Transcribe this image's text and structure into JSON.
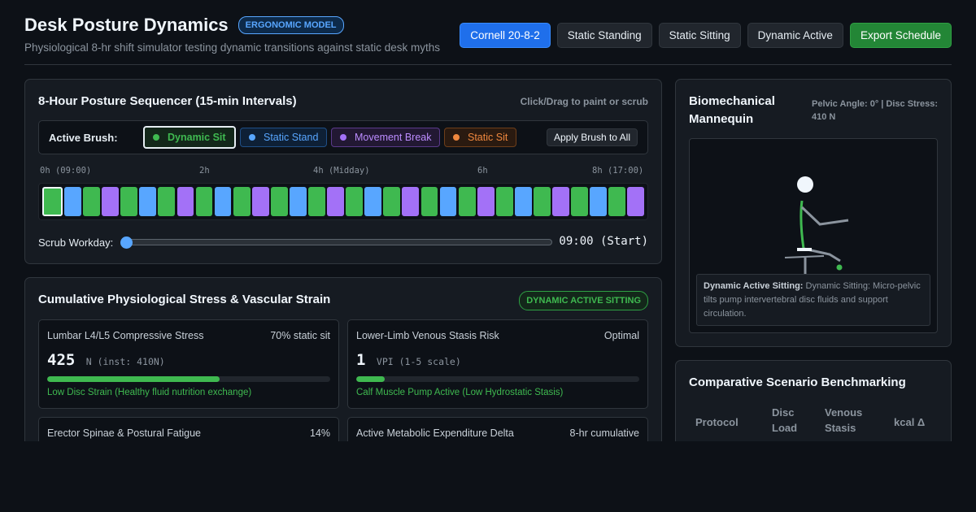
{
  "header": {
    "title": "Desk Posture Dynamics",
    "badge": "ERGONOMIC MODEL",
    "subtitle": "Physiological 8-hr shift simulator testing dynamic transitions against static desk myths",
    "buttons": [
      "Cornell 20-8-2",
      "Static Standing",
      "Static Sitting",
      "Dynamic Active",
      "Export Schedule"
    ],
    "active_button": "Cornell 20-8-2"
  },
  "sequencer": {
    "title": "8-Hour Posture Sequencer (15-min Intervals)",
    "hint": "Click/Drag to paint or scrub",
    "brush_label": "Active Brush:",
    "brushes": {
      "dynamic_sit": "Dynamic Sit",
      "static_stand": "Static Stand",
      "movement_break": "Movement Break",
      "static_sit": "Static Sit"
    },
    "active_brush": "Dynamic Sit",
    "apply_label": "Apply Brush to All",
    "time_axis": [
      "0h (09:00)",
      "2h",
      "4h (Midday)",
      "6h",
      "8h (17:00)"
    ],
    "blocks": [
      "dyn",
      "stand",
      "dyn",
      "move",
      "dyn",
      "stand",
      "dyn",
      "move",
      "dyn",
      "stand",
      "dyn",
      "move",
      "dyn",
      "stand",
      "dyn",
      "move",
      "dyn",
      "stand",
      "dyn",
      "move",
      "dyn",
      "stand",
      "dyn",
      "move",
      "dyn",
      "stand",
      "dyn",
      "move",
      "dyn",
      "stand",
      "dyn",
      "move"
    ],
    "scrub_label": "Scrub Workday:",
    "scrub_time": "09:00 (Start)",
    "scrub_position": 0
  },
  "colors": {
    "dyn": "#3fb950",
    "stand": "#58a6ff",
    "move": "#a371f7",
    "static_sit": "#f0883e"
  },
  "stress": {
    "title": "Cumulative Physiological Stress & Vascular Strain",
    "mode_badge": "DYNAMIC ACTIVE SITTING",
    "cards": [
      {
        "title": "Lumbar L4/L5 Compressive Stress",
        "meta": "70% static sit",
        "value": "425",
        "unit": "N (inst: 410N)",
        "fill": 0.61,
        "note": "Low Disc Strain (Healthy fluid nutrition exchange)"
      },
      {
        "title": "Lower-Limb Venous Stasis Risk",
        "meta": "Optimal",
        "value": "1",
        "unit": "VPI (1-5 scale)",
        "fill": 0.1,
        "note": "Calf Muscle Pump Active (Low Hydrostatic Stasis)"
      },
      {
        "title": "Erector Spinae & Postural Fatigue",
        "meta": "14%"
      },
      {
        "title": "Active Metabolic Expenditure Delta",
        "meta": "8-hr cumulative"
      }
    ]
  },
  "mannequin": {
    "title": "Biomechanical Mannequin",
    "stats": "Pelvic Angle: 0° | Disc Stress: 410 N",
    "tooltip_bold": "Dynamic Active Sitting:",
    "tooltip_text": "Dynamic Sitting: Micro-pelvic tilts pump intervertebral disc fluids and support circulation."
  },
  "benchmark": {
    "title": "Comparative Scenario Benchmarking",
    "columns": [
      "Protocol",
      "Disc Load",
      "Venous Stasis",
      "kcal Δ"
    ]
  }
}
